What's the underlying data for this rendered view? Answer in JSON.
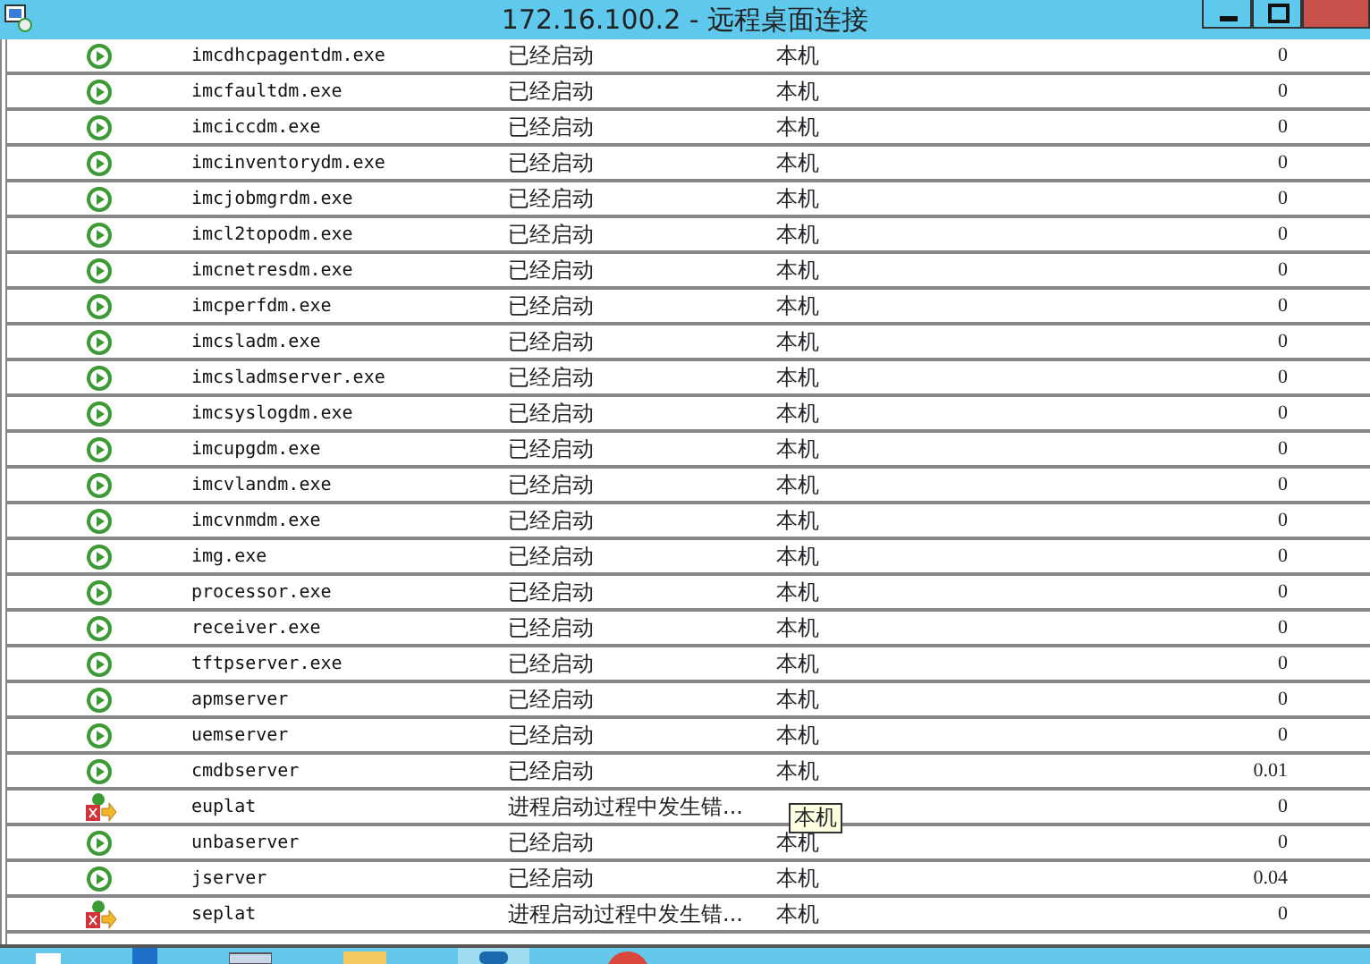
{
  "window": {
    "title": "172.16.100.2 - 远程桌面连接"
  },
  "rows": [
    {
      "kind": "running",
      "name": "imcdhcpagentdm.exe",
      "status": "已经启动",
      "location": "本机",
      "value": "0"
    },
    {
      "kind": "running",
      "name": "imcfaultdm.exe",
      "status": "已经启动",
      "location": "本机",
      "value": "0"
    },
    {
      "kind": "running",
      "name": "imciccdm.exe",
      "status": "已经启动",
      "location": "本机",
      "value": "0"
    },
    {
      "kind": "running",
      "name": "imcinventorydm.exe",
      "status": "已经启动",
      "location": "本机",
      "value": "0"
    },
    {
      "kind": "running",
      "name": "imcjobmgrdm.exe",
      "status": "已经启动",
      "location": "本机",
      "value": "0"
    },
    {
      "kind": "running",
      "name": "imcl2topodm.exe",
      "status": "已经启动",
      "location": "本机",
      "value": "0"
    },
    {
      "kind": "running",
      "name": "imcnetresdm.exe",
      "status": "已经启动",
      "location": "本机",
      "value": "0"
    },
    {
      "kind": "running",
      "name": "imcperfdm.exe",
      "status": "已经启动",
      "location": "本机",
      "value": "0"
    },
    {
      "kind": "running",
      "name": "imcsladm.exe",
      "status": "已经启动",
      "location": "本机",
      "value": "0"
    },
    {
      "kind": "running",
      "name": "imcsladmserver.exe",
      "status": "已经启动",
      "location": "本机",
      "value": "0"
    },
    {
      "kind": "running",
      "name": "imcsyslogdm.exe",
      "status": "已经启动",
      "location": "本机",
      "value": "0"
    },
    {
      "kind": "running",
      "name": "imcupgdm.exe",
      "status": "已经启动",
      "location": "本机",
      "value": "0"
    },
    {
      "kind": "running",
      "name": "imcvlandm.exe",
      "status": "已经启动",
      "location": "本机",
      "value": "0"
    },
    {
      "kind": "running",
      "name": "imcvnmdm.exe",
      "status": "已经启动",
      "location": "本机",
      "value": "0"
    },
    {
      "kind": "running",
      "name": "img.exe",
      "status": "已经启动",
      "location": "本机",
      "value": "0"
    },
    {
      "kind": "running",
      "name": "processor.exe",
      "status": "已经启动",
      "location": "本机",
      "value": "0"
    },
    {
      "kind": "running",
      "name": "receiver.exe",
      "status": "已经启动",
      "location": "本机",
      "value": "0"
    },
    {
      "kind": "running",
      "name": "tftpserver.exe",
      "status": "已经启动",
      "location": "本机",
      "value": "0"
    },
    {
      "kind": "running",
      "name": "apmserver",
      "status": "已经启动",
      "location": "本机",
      "value": "0"
    },
    {
      "kind": "running",
      "name": "uemserver",
      "status": "已经启动",
      "location": "本机",
      "value": "0"
    },
    {
      "kind": "running",
      "name": "cmdbserver",
      "status": "已经启动",
      "location": "本机",
      "value": "0.01"
    },
    {
      "kind": "error",
      "name": "euplat",
      "status": "进程启动过程中发生错...",
      "value": "0"
    },
    {
      "kind": "running",
      "name": "unbaserver",
      "status": "已经启动",
      "location": "本机",
      "value": "0"
    },
    {
      "kind": "running",
      "name": "jserver",
      "status": "已经启动",
      "location": "本机",
      "value": "0.04"
    },
    {
      "kind": "error",
      "name": "seplat",
      "status": "进程启动过程中发生错...",
      "location": "本机",
      "value": "0"
    }
  ],
  "tooltip": {
    "text": "本机"
  }
}
